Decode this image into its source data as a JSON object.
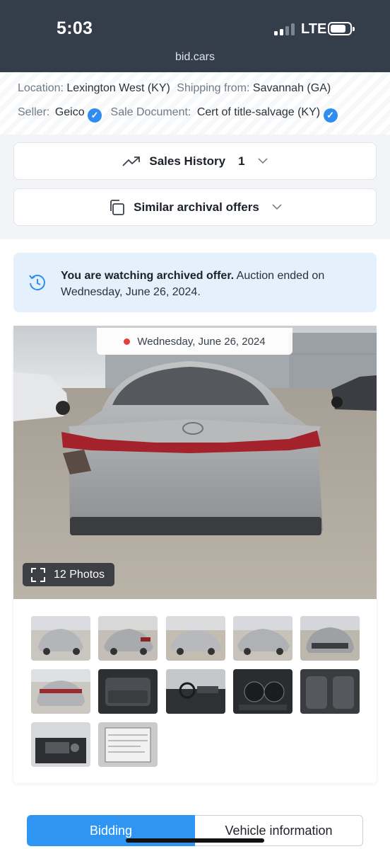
{
  "status_bar": {
    "time": "5:03",
    "network": "LTE",
    "url": "bid.cars"
  },
  "info": {
    "location_label": "Location:",
    "location_value": "Lexington West (KY)",
    "shipping_label": "Shipping from:",
    "shipping_value": "Savannah (GA)",
    "seller_label": "Seller:",
    "seller_value": "Geico",
    "document_label": "Sale Document:",
    "document_value": "Cert of title-salvage (KY)"
  },
  "sales_history": {
    "label": "Sales History",
    "count": "1"
  },
  "similar": {
    "label": "Similar archival offers"
  },
  "notice": {
    "bold": "You are watching archived offer.",
    "text": " Auction ended on Wednesday, June 26, 2024."
  },
  "gallery": {
    "date": "Wednesday, June 26, 2024",
    "photos_label": "12 Photos",
    "photo_count": 12
  },
  "thumbnails": [
    "rear-left-view",
    "rear-right-view",
    "front-left-view",
    "front-left-side",
    "front-view",
    "rear-view",
    "interior-rear-seats",
    "dashboard",
    "gauge-cluster",
    "front-seats",
    "engine-bay",
    "window-sticker"
  ],
  "tabs": {
    "active": "Bidding",
    "inactive": "Vehicle information"
  },
  "colors": {
    "accent": "#2f95f2",
    "header": "#343e4b",
    "notice_bg": "#e4f1fd",
    "verified": "#2f8cf0",
    "live_dot": "#e53c3c"
  }
}
